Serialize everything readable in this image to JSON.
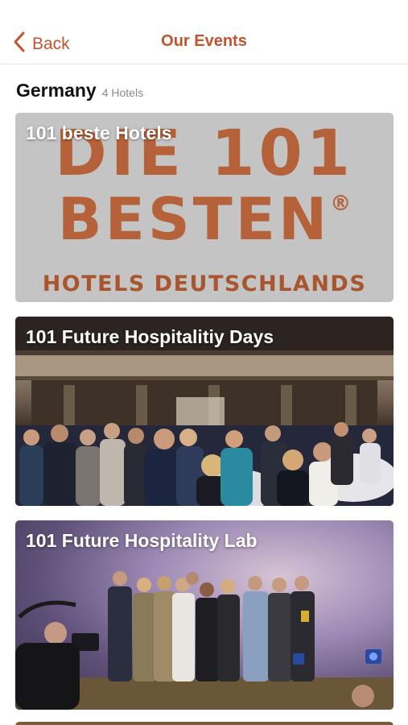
{
  "nav": {
    "back_label": "Back",
    "title": "Our Events"
  },
  "section": {
    "title": "Germany",
    "count": "4 Hotels"
  },
  "events": [
    {
      "title": "101 beste Hotels",
      "logo": {
        "line1": "DIE 101",
        "line2": "BESTEN",
        "registered": "®",
        "line3": "HOTELS DEUTSCHLANDS"
      }
    },
    {
      "title": "101 Future Hospitalitiy Days"
    },
    {
      "title": "101 Future Hospitality Lab"
    }
  ],
  "colors": {
    "accent": "#c2532f",
    "logo": "#b5623a",
    "card1_bg": "#c4c4c4"
  }
}
